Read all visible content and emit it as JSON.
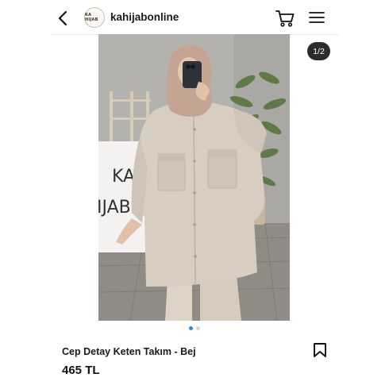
{
  "header": {
    "logo_text": "KA HIJAB",
    "store_name": "kahijabonline",
    "back_icon": "chevron-left-icon",
    "cart_icon": "cart-icon",
    "menu_icon": "hamburger-menu-icon"
  },
  "gallery": {
    "counter": "1/2",
    "sign_text": "KA HIJAB",
    "dots_total": 2,
    "dot_active_index": 0,
    "accent_color": "#2a8fd6"
  },
  "product": {
    "title": "Cep Detay Keten Takım - Bej",
    "price": "465 TL",
    "bookmark_icon": "bookmark-icon"
  }
}
